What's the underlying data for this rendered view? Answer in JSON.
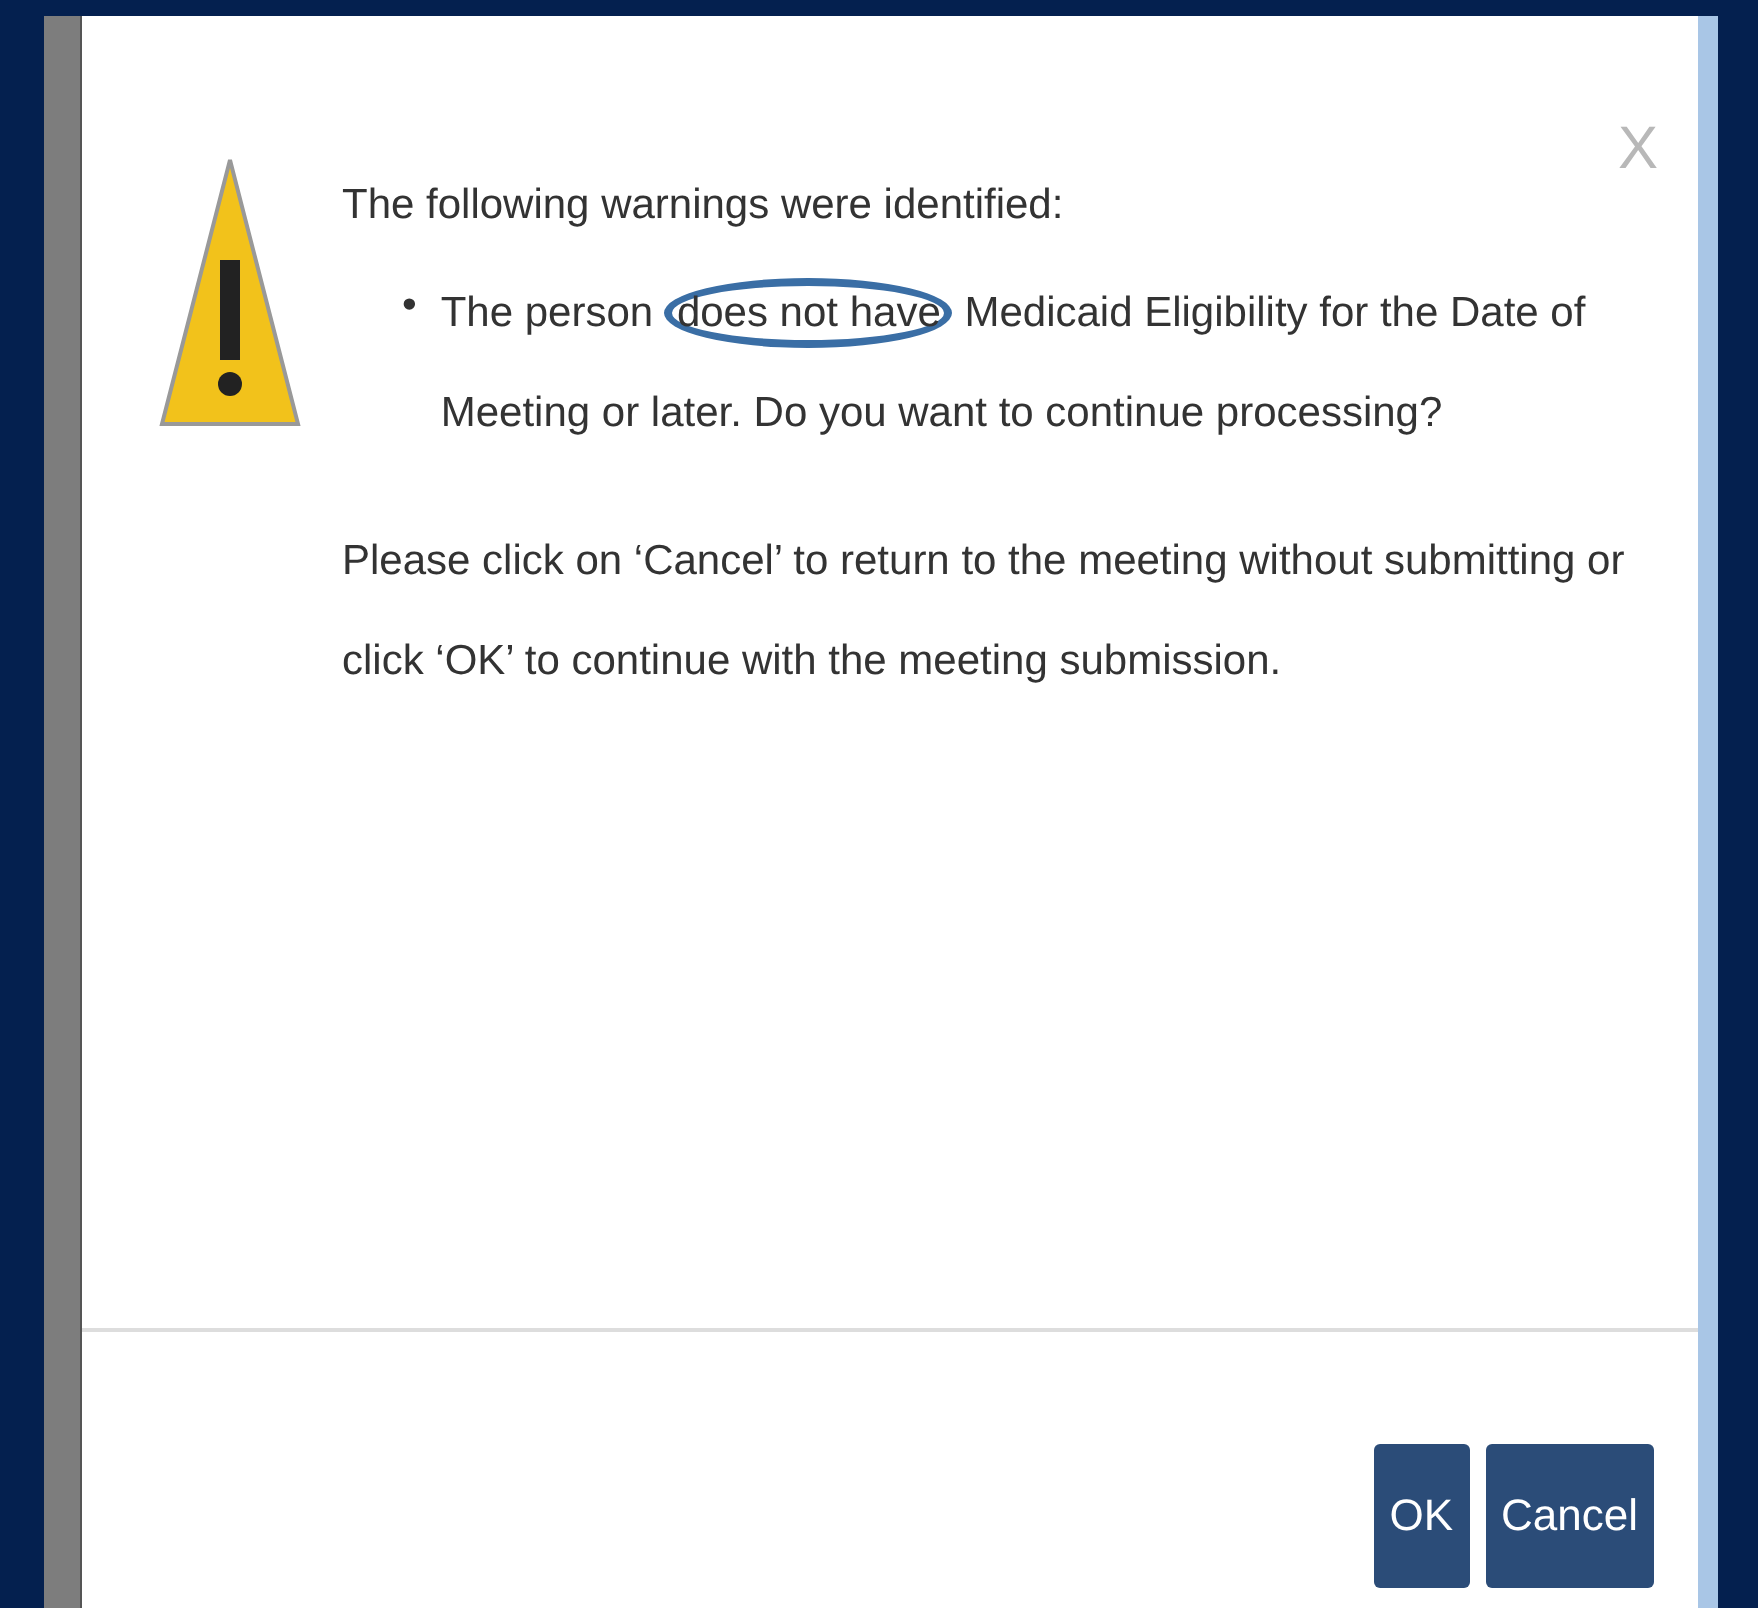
{
  "dialog": {
    "close": "X",
    "heading": "The following warnings were identified:",
    "warnings": [
      {
        "bullet": "•",
        "parts": [
          {
            "text": "The person",
            "circled": false
          },
          {
            "text": "does not have",
            "circled": true
          },
          {
            "text": "Medicaid Eligibility for the Date of Meeting or later. Do you want to continue processing?",
            "circled": false
          }
        ]
      }
    ],
    "instruction": "Please click on ‘Cancel’ to return to the meeting without submitting or click ‘OK’ to continue with the meeting submission.",
    "buttons": [
      "OK",
      "Cancel"
    ]
  }
}
